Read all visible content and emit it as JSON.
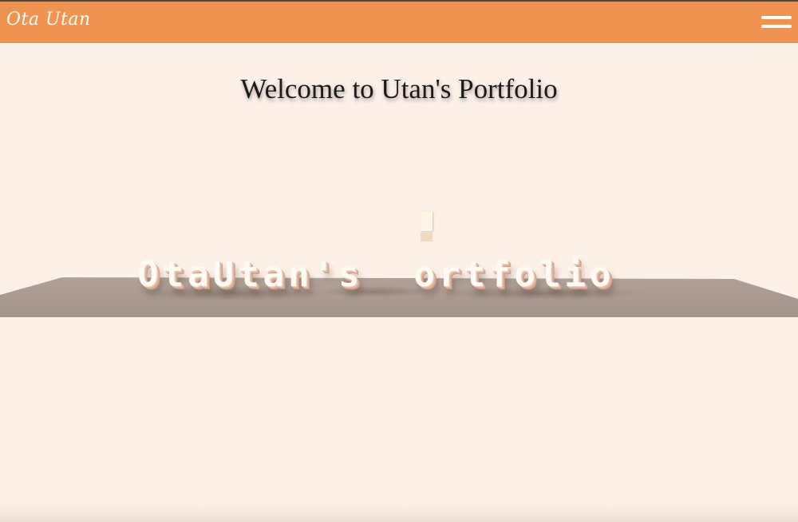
{
  "navbar": {
    "brand": "Ota Utan",
    "menu_icon": "hamburger-menu-icon",
    "background_color": "#ef934f"
  },
  "main": {
    "welcome_title": "Welcome to Utan's Portfolio"
  },
  "scene": {
    "text_3d": "OtaUtan's  ortfolio",
    "floor_color": "#a8978b",
    "text_color": "#fffaf2"
  },
  "page": {
    "background_color": "#fdf0e7"
  }
}
